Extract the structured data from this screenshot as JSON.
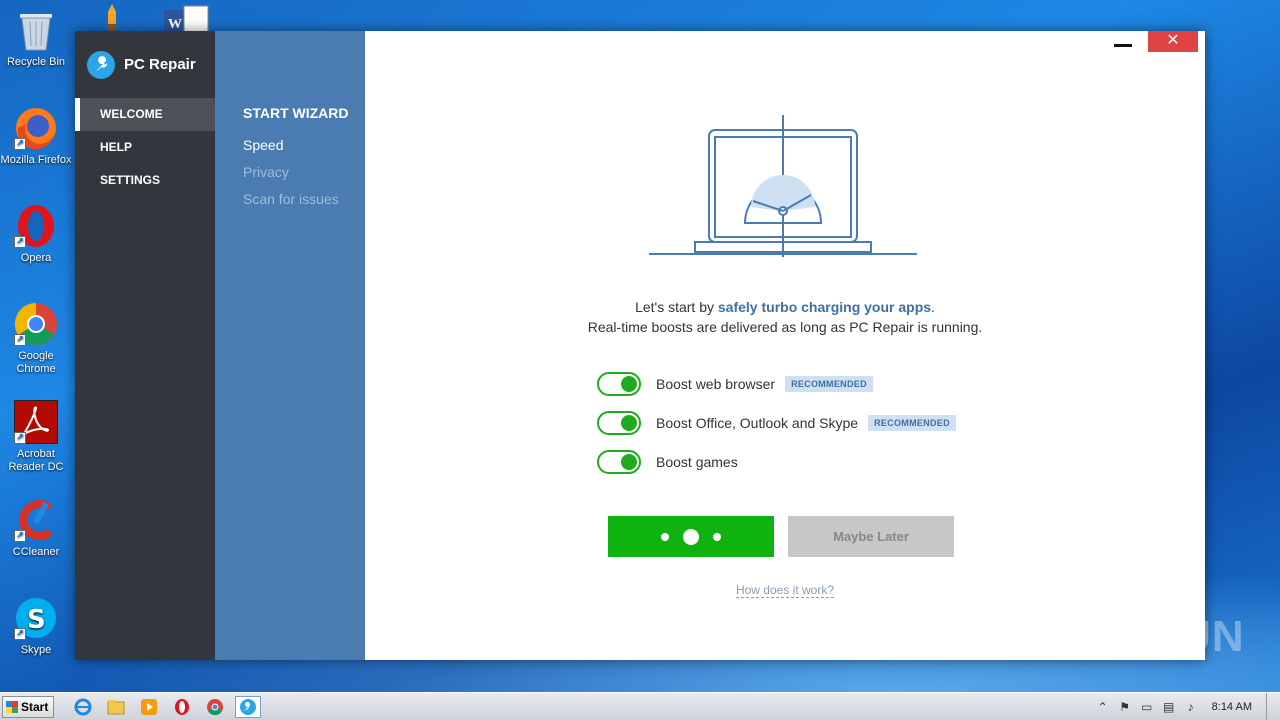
{
  "desktop": {
    "icons": [
      {
        "label": "Recycle Bin",
        "icon": "recycle-bin-icon"
      },
      {
        "label": "Mozilla Firefox",
        "icon": "firefox-icon"
      },
      {
        "label": "Opera",
        "icon": "opera-icon"
      },
      {
        "label": "Google Chrome",
        "icon": "chrome-icon"
      },
      {
        "label": "Acrobat Reader DC",
        "icon": "acrobat-icon"
      },
      {
        "label": "CCleaner",
        "icon": "ccleaner-icon"
      },
      {
        "label": "Skype",
        "icon": "skype-icon"
      }
    ],
    "watermark": "ANY RUN"
  },
  "app": {
    "name": "PC Repair",
    "nav": [
      {
        "label": "WELCOME",
        "active": true
      },
      {
        "label": "HELP",
        "active": false
      },
      {
        "label": "SETTINGS",
        "active": false
      }
    ],
    "wizard": {
      "title": "START WIZARD",
      "steps": [
        {
          "label": "Speed",
          "current": true
        },
        {
          "label": "Privacy",
          "current": false
        },
        {
          "label": "Scan for issues",
          "current": false
        }
      ]
    },
    "window_controls": {
      "close_glyph": "✕"
    },
    "intro": {
      "line1_prefix": "Let's start by ",
      "line1_bold": "safely turbo charging your apps",
      "line1_suffix": ".",
      "line2": "Real-time boosts are delivered as long as PC Repair is running."
    },
    "boosts": [
      {
        "label": "Boost web browser",
        "badge": "RECOMMENDED",
        "enabled": true
      },
      {
        "label": "Boost Office, Outlook and Skype",
        "badge": "RECOMMENDED",
        "enabled": true
      },
      {
        "label": "Boost games",
        "badge": "",
        "enabled": true
      }
    ],
    "maybe_later": "Maybe Later",
    "how_link": "How does it work?"
  },
  "taskbar": {
    "start_label": "Start",
    "clock": "8:14 AM",
    "colors": {
      "accent_green": "#0fb30f",
      "nav_dark": "#33363c",
      "wizard_blue": "#4a7bb1"
    }
  }
}
